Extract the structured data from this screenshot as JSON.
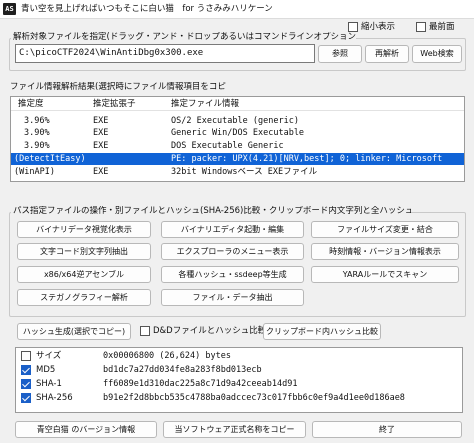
{
  "window": {
    "icon_text": "AS",
    "title": "青い空を見上げればいつもそこに白い猫　for うさみみハリケーン",
    "always_small_label": "縮小表示",
    "topmost_label": "最前面"
  },
  "target": {
    "section_label": "解析対象ファイルを指定(ドラッグ・アンド・ドロップあるいはコマンドラインオプションでの指定可)",
    "path": "C:\\picoCTF2024\\WinAntiDbg0x300.exe",
    "browse_label": "参照",
    "reanalyze_label": "再解析",
    "web_search_label": "Web検索"
  },
  "analysis": {
    "section_label": "ファイル情報解析結果(選択時にファイル情報項目をコピー)",
    "columns": [
      "推定度",
      "推定拡張子",
      "推定ファイル情報"
    ],
    "rows": [
      {
        "degree": "",
        "ext": "",
        "info": ""
      },
      {
        "degree": "3.96%",
        "ext": "EXE",
        "info": "OS/2 Executable (generic)"
      },
      {
        "degree": "3.90%",
        "ext": "EXE",
        "info": "Generic Win/DOS Executable"
      },
      {
        "degree": "3.90%",
        "ext": "EXE",
        "info": "DOS Executable Generic"
      },
      {
        "degree": "(DetectItEasy)",
        "ext": "",
        "info": "PE: packer: UPX(4.21)[NRV,best]; 0; linker: Microsoft"
      },
      {
        "degree": "(WinAPI)",
        "ext": "EXE",
        "info": "32bit Windowsベース EXEファイル"
      }
    ]
  },
  "tools": {
    "section_label": "パス指定ファイルの操作・別ファイルとハッシュ(SHA-256)比較・クリップボード内文字列と全ハッシュ文字列を個別比較",
    "buttons": [
      "バイナリデータ視覚化表示",
      "バイナリエディタ起動・編集",
      "ファイルサイズ変更・結合",
      "文字コード別文字列抽出",
      "エクスプローラのメニュー表示",
      "時刻情報・バージョン情報表示",
      "x86/x64逆アセンブル",
      "各種ハッシュ・ssdeep等生成",
      "YARAルールでスキャン",
      "ステガノグラフィー解析",
      "ファイル・データ抽出"
    ],
    "hash_gen_label": "ハッシュ生成(選択でコピー)",
    "d8d_compare_label": "D&Dファイルとハッシュ比較",
    "clipboard_compare_label": "クリップボード内ハッシュ比較"
  },
  "hashes": [
    {
      "key": "サイズ",
      "value": "0x00006800 (26,624) bytes",
      "checked": false
    },
    {
      "key": "MD5",
      "value": "bd1dc7a27dd034fe8a283f8bd013ecb",
      "checked": true
    },
    {
      "key": "SHA-1",
      "value": "ff6089e1d310dac225a8c71d9a42ceeab14d91",
      "checked": true
    },
    {
      "key": "SHA-256",
      "value": "b91e2f2d8bbcb535c4788ba0adccec73c017fbb6c0ef9a4d1ee0d186ae8",
      "checked": true
    }
  ],
  "footer": {
    "version_label": "青空白猫 のバージョン情報",
    "official_name_label": "当ソフトウェア正式名称をコピー",
    "exit_label": "終了"
  }
}
